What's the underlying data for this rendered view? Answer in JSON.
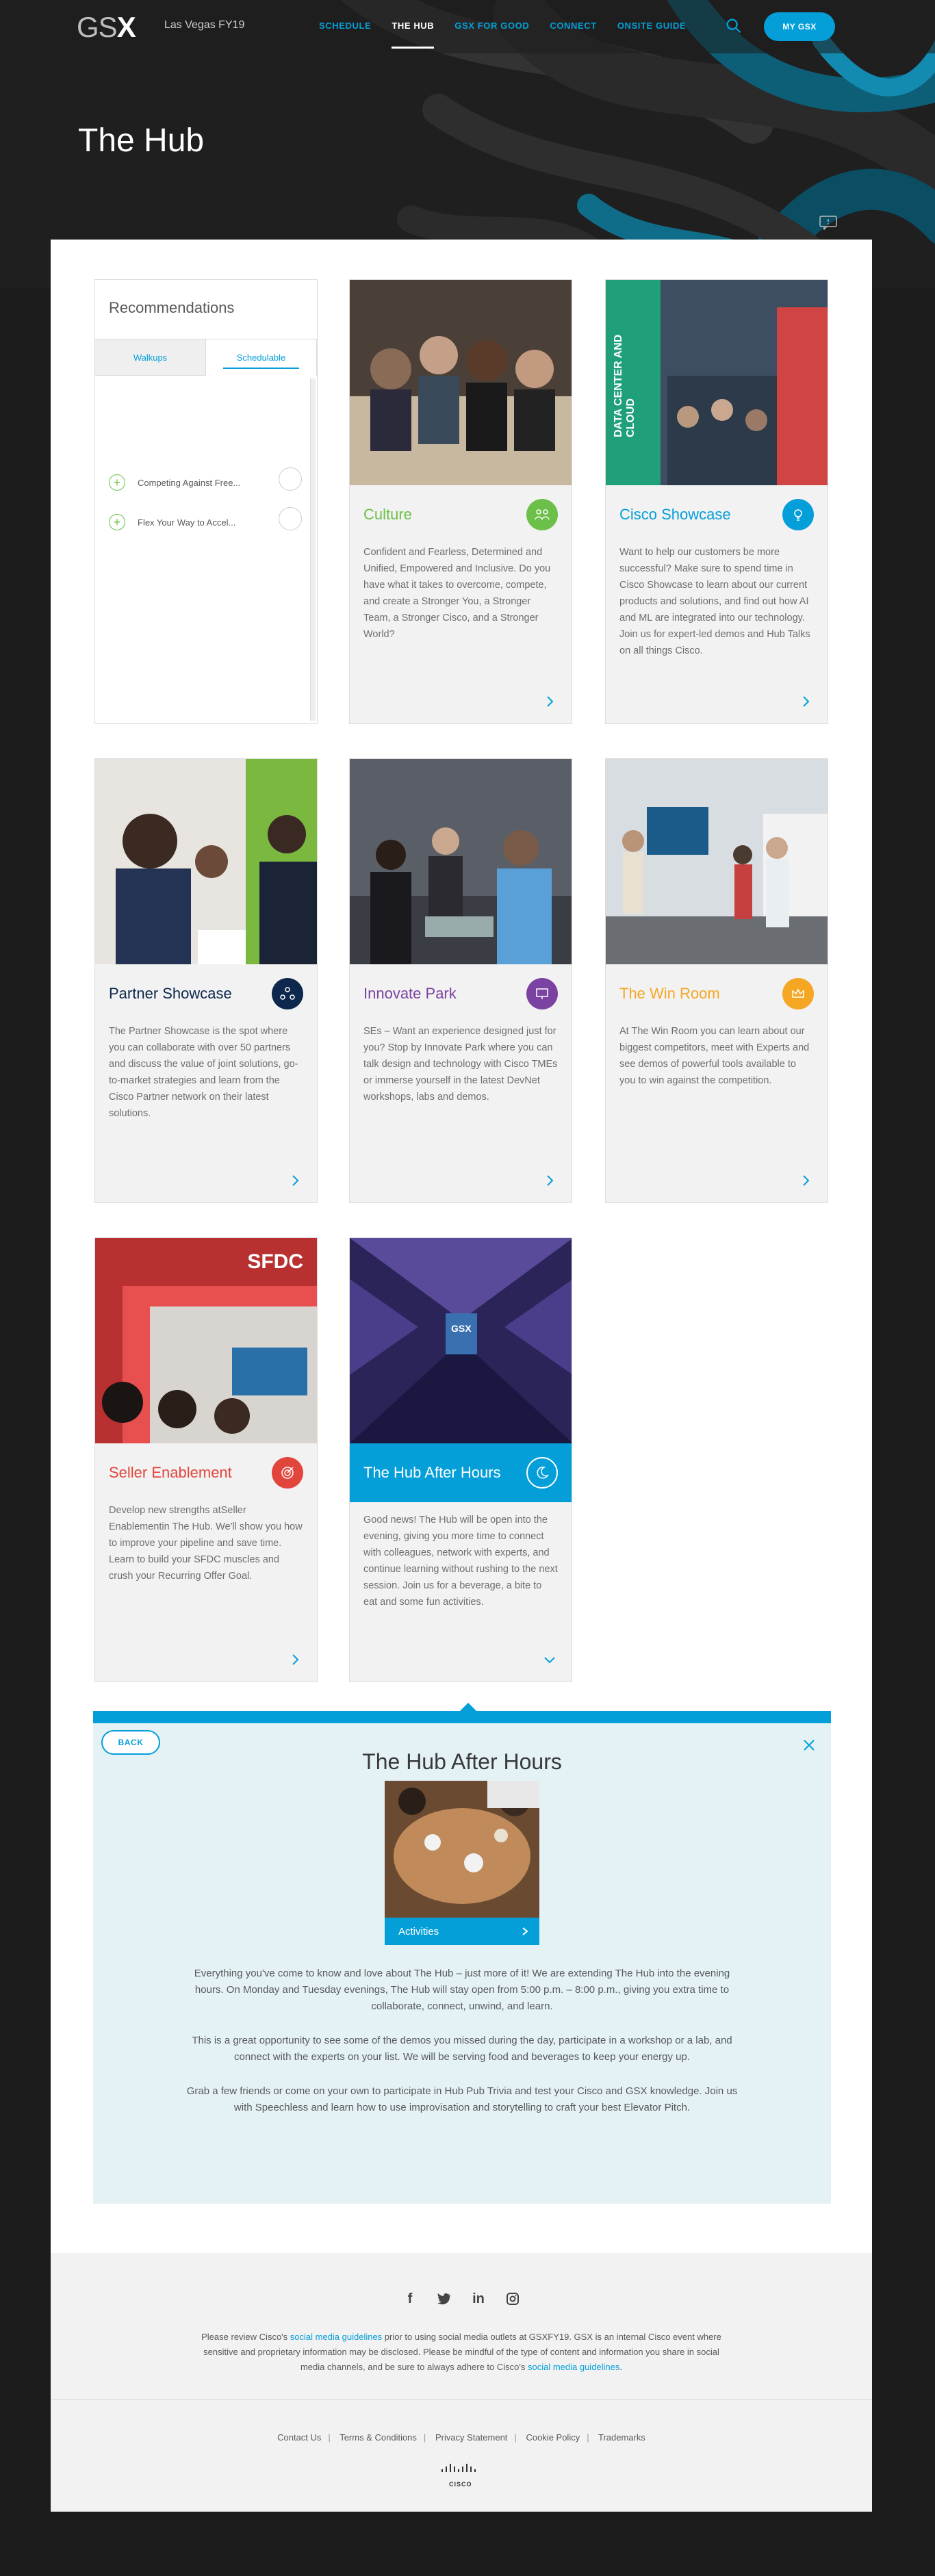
{
  "nav": {
    "logo_light": "GS",
    "logo_bold": "X",
    "event": "Las Vegas FY19",
    "links": [
      "SCHEDULE",
      "THE HUB",
      "GSX FOR GOOD",
      "CONNECT",
      "ONSITE GUIDE"
    ],
    "active": "THE HUB",
    "my_gsx": "MY GSX"
  },
  "page_title": "The Hub",
  "recommendations": {
    "title": "Recommendations",
    "tabs": [
      "Walkups",
      "Schedulable"
    ],
    "selected_tab": "Schedulable",
    "items": [
      "Competing Against Free...",
      "Flex Your Way to Accel..."
    ]
  },
  "cards": [
    {
      "title": "Culture",
      "color": "#6cc04a",
      "icon": "people-heart-icon",
      "desc": "Confident and Fearless, Determined and Unified, Empowered and Inclusive. Do you have what it takes to overcome, compete, and create a Stronger You, a Stronger Team, a Stronger Cisco, and a Stronger World?"
    },
    {
      "title": "Cisco Showcase",
      "color": "#049fd9",
      "icon": "lightbulb-icon",
      "image_text": "DATA CENTER AND CLOUD",
      "desc": "Want to help our customers be more successful? Make sure to spend time in Cisco Showcase to learn about our current products and solutions, and find out how AI and ML are integrated into our technology. Join us for expert-led demos and Hub Talks on all things Cisco."
    },
    {
      "title": "Partner Showcase",
      "color": "#0d274d",
      "icon": "network-people-icon",
      "desc": "The Partner Showcase is the spot where you can collaborate with over 50 partners and discuss the value of joint solutions, go-to-market strategies and learn from the Cisco Partner network on their latest solutions."
    },
    {
      "title": "Innovate Park",
      "color": "#7b43a1",
      "icon": "presentation-icon",
      "desc": "SEs – Want an experience designed just for you? Stop by Innovate Park where you can talk design and technology with Cisco TMEs or immerse yourself in the latest DevNet workshops, labs and demos."
    },
    {
      "title": "The Win Room",
      "color": "#f5a623",
      "icon": "crown-icon",
      "desc": "At The Win Room you can learn about our biggest competitors, meet with Experts and see demos of powerful tools available to you to win against the competition."
    },
    {
      "title": "Seller Enablement",
      "color": "#e2453c",
      "icon": "target-icon",
      "image_text": "SFDC",
      "desc": "Develop new strengths atSeller Enablementin The Hub. We'll show you how to improve your pipeline and save time. Learn to build your SFDC muscles and crush your Recurring Offer Goal."
    },
    {
      "title": "The Hub After Hours",
      "color": "#049fd9",
      "icon": "moon-icon",
      "image_text": "GSX",
      "desc": "Good news! The Hub will be open into the evening, giving you more time to connect with colleagues, network with experts, and continue learning without rushing to the next session. Join us for a beverage, a bite to eat and some fun activities."
    }
  ],
  "detail": {
    "back": "BACK",
    "title": "The Hub After Hours",
    "activity_label": "Activities",
    "paragraphs": [
      "Everything you've come to know and love about The Hub – just more of it! We are extending The Hub into the evening hours. On Monday and Tuesday evenings, The Hub will stay open from 5:00 p.m. – 8:00 p.m., giving you extra time to collaborate, connect, unwind, and learn.",
      "This is a great opportunity to see some of the demos you missed during the day, participate in a workshop or a lab, and connect with the experts on your list. We will be serving food and beverages to keep your energy up.",
      "Grab a few friends or come on your own to participate in Hub Pub Trivia and test your Cisco and GSX knowledge. Join us with Speechless and learn how to use improvisation and storytelling to craft your best Elevator Pitch."
    ]
  },
  "footer": {
    "social": [
      "f",
      "t",
      "in",
      "ig"
    ],
    "legal_1": "Please review Cisco's ",
    "legal_link": "social media guidelines",
    "legal_2": " prior to using social media outlets at GSXFY19. GSX is an internal Cisco event where sensitive and proprietary information may be disclosed. Please be mindful of the type of content and information you share in social media channels, and be sure to always adhere to Cisco's ",
    "legal_link2": "social media guidelines",
    "legal_3": ".",
    "links": [
      "Contact Us",
      "Terms & Conditions",
      "Privacy Statement",
      "Cookie Policy",
      "Trademarks"
    ],
    "brand": "CISCO"
  }
}
